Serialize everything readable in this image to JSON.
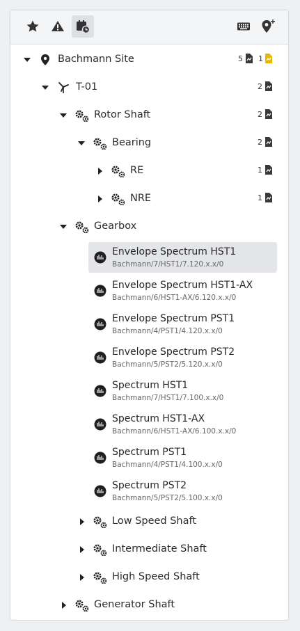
{
  "toolbar": {
    "favorites": "star-icon",
    "alarms": "warning-icon",
    "schedule": "calendar-clock-icon",
    "keyboard": "keyboard-icon",
    "add_location": "add-location-icon"
  },
  "tree": {
    "site": {
      "label": "Bachmann Site",
      "count_a": "5",
      "count_b": "1",
      "highlight_color": "#e6b800"
    },
    "turbine": {
      "label": "T-01",
      "count": "2"
    },
    "rotor_shaft": {
      "label": "Rotor Shaft",
      "count": "2"
    },
    "bearing": {
      "label": "Bearing",
      "count": "2"
    },
    "re": {
      "label": "RE",
      "count": "1"
    },
    "nre": {
      "label": "NRE",
      "count": "1"
    },
    "gearbox": {
      "label": "Gearbox"
    },
    "measurements": [
      {
        "title": "Envelope Spectrum HST1",
        "path": "Bachmann/7/HST1/7.120.x.x/0"
      },
      {
        "title": "Envelope Spectrum HST1-AX",
        "path": "Bachmann/6/HST1-AX/6.120.x.x/0"
      },
      {
        "title": "Envelope Spectrum PST1",
        "path": "Bachmann/4/PST1/4.120.x.x/0"
      },
      {
        "title": "Envelope Spectrum PST2",
        "path": "Bachmann/5/PST2/5.120.x.x/0"
      },
      {
        "title": "Spectrum HST1",
        "path": "Bachmann/7/HST1/7.100.x.x/0"
      },
      {
        "title": "Spectrum HST1-AX",
        "path": "Bachmann/6/HST1-AX/6.100.x.x/0"
      },
      {
        "title": "Spectrum PST1",
        "path": "Bachmann/4/PST1/4.100.x.x/0"
      },
      {
        "title": "Spectrum PST2",
        "path": "Bachmann/5/PST2/5.100.x.x/0"
      }
    ],
    "low_speed_shaft": {
      "label": "Low Speed Shaft"
    },
    "intermediate_shaft": {
      "label": "Intermediate Shaft"
    },
    "high_speed_shaft": {
      "label": "High Speed Shaft"
    },
    "generator_shaft": {
      "label": "Generator Shaft"
    }
  }
}
